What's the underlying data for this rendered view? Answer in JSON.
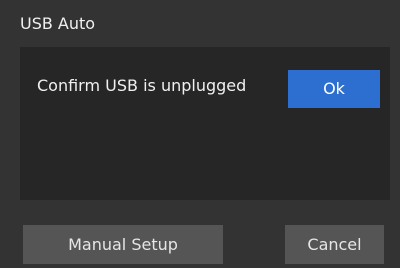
{
  "dialog": {
    "title": "USB Auto",
    "message": "Confirm USB is unplugged",
    "ok_label": "Ok",
    "manual_setup_label": "Manual Setup",
    "cancel_label": "Cancel"
  },
  "colors": {
    "background": "#333333",
    "panel": "#262626",
    "primary_button": "#2d6fd0",
    "secondary_button": "#555555",
    "text": "#f0f0f0"
  }
}
